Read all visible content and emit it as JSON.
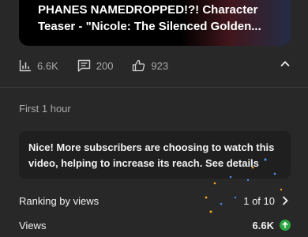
{
  "video": {
    "title_line1": "PHANES NAMEDROPPED!?! Character",
    "title_line2": "Teaser - \"Nicole: The Silenced Golden..."
  },
  "stats": {
    "views": "6.6K",
    "comments": "200",
    "likes": "923"
  },
  "period_label": "First 1 hour",
  "notice": {
    "text": "Nice! More subscribers are choosing to watch this video, helping to increase its reach.",
    "link": "See details"
  },
  "ranking": {
    "label": "Ranking by views",
    "value": "1 of 10"
  },
  "views_row": {
    "label": "Views",
    "value": "6.6K"
  },
  "colors": {
    "background": "#282828",
    "secondary_text": "#aaaaaa",
    "positive": "#2ba640"
  },
  "icons": [
    "bar-chart-icon",
    "comment-icon",
    "thumbs-up-icon",
    "chevron-up-icon",
    "chevron-right-icon",
    "arrow-up-icon"
  ]
}
